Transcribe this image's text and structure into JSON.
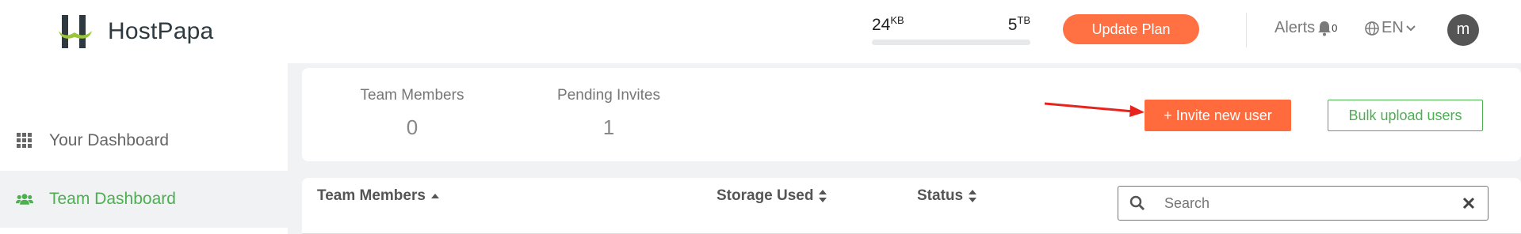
{
  "header": {
    "brand": "HostPapa",
    "storage": {
      "used": "24",
      "used_unit": "KB",
      "total": "5",
      "total_unit": "TB",
      "fraction_used": 0.0
    },
    "update_plan_label": "Update Plan",
    "alerts_label": "Alerts",
    "alerts_count": "0",
    "language": "EN",
    "avatar_initial": "m"
  },
  "sidebar": {
    "items": [
      {
        "label": "Your Dashboard",
        "icon": "grid-icon",
        "active": false
      },
      {
        "label": "Team Dashboard",
        "icon": "users-icon",
        "active": true
      }
    ]
  },
  "summary": {
    "team_members_label": "Team Members",
    "team_members_value": "0",
    "pending_invites_label": "Pending Invites",
    "pending_invites_value": "1",
    "invite_label": "+ Invite new user",
    "bulk_label": "Bulk upload users"
  },
  "table": {
    "columns": [
      "Team Members",
      "Storage Used",
      "Status"
    ],
    "search_placeholder": "Search"
  },
  "colors": {
    "accent": "#ff6b3d",
    "green": "#4caf50",
    "annotation_arrow": "#e8231c"
  }
}
